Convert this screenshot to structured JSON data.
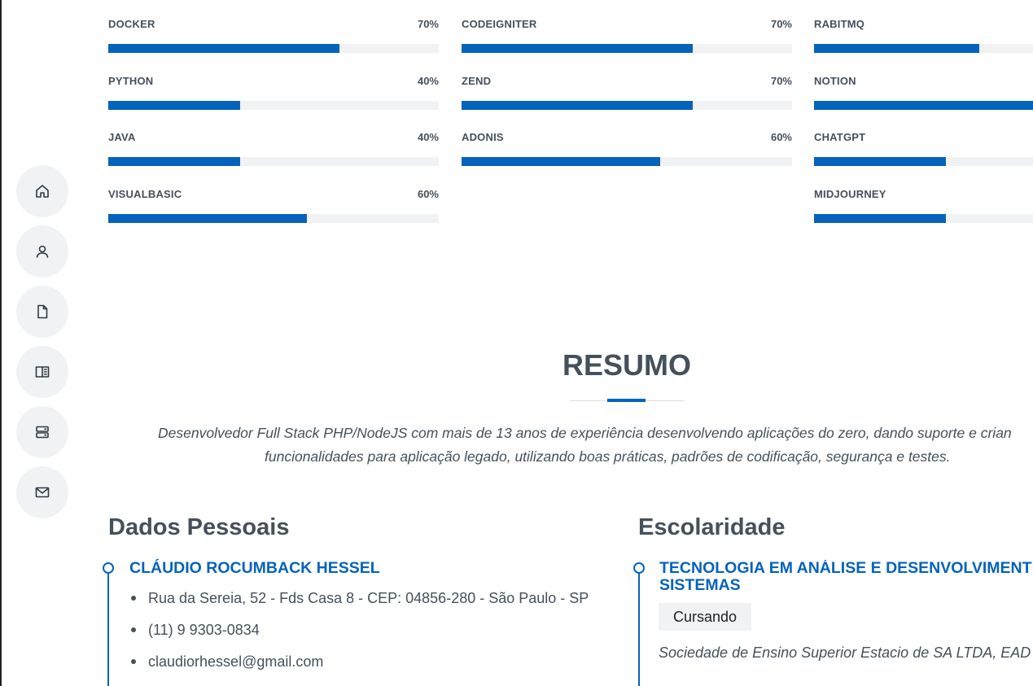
{
  "nav": {
    "items": [
      {
        "name": "home-icon"
      },
      {
        "name": "user-icon"
      },
      {
        "name": "file-icon"
      },
      {
        "name": "book-icon"
      },
      {
        "name": "server-icon"
      },
      {
        "name": "mail-icon"
      }
    ]
  },
  "skills": {
    "columns": [
      [
        {
          "name": "DOCKER",
          "value": "70%",
          "percent": 70
        },
        {
          "name": "PYTHON",
          "value": "40%",
          "percent": 40
        },
        {
          "name": "JAVA",
          "value": "40%",
          "percent": 40
        },
        {
          "name": "VISUALBASIC",
          "value": "60%",
          "percent": 60
        }
      ],
      [
        {
          "name": "CODEIGNITER",
          "value": "70%",
          "percent": 70
        },
        {
          "name": "ZEND",
          "value": "70%",
          "percent": 70
        },
        {
          "name": "ADONIS",
          "value": "60%",
          "percent": 60
        }
      ],
      [
        {
          "name": "RABITMQ",
          "value": "",
          "percent": 50
        },
        {
          "name": "NOTION",
          "value": "",
          "percent": 67
        },
        {
          "name": "CHATGPT",
          "value": "",
          "percent": 40
        },
        {
          "name": "MIDJOURNEY",
          "value": "",
          "percent": 40
        }
      ]
    ]
  },
  "resumo": {
    "title": "RESUMO",
    "line1": "Desenvolvedor Full Stack PHP/NodeJS com mais de 13 anos de experiência desenvolvendo aplicações do zero, dando suporte e crian",
    "line2": "funcionalidades para aplicação legado, utilizando boas práticas, padrões de codificação, segurança e testes."
  },
  "dados": {
    "title": "Dados Pessoais",
    "name": "CLÁUDIO ROCUMBACK HESSEL",
    "address": "Rua da Sereia, 52 - Fds Casa 8 - CEP: 04856-280 - São Paulo - SP",
    "phone": "(11) 9 9303-0834",
    "email": "claudiorhessel@gmail.com"
  },
  "escolaridade": {
    "title": "Escolaridade",
    "course_line1": "TECNOLOGIA EM ANÁLISE E DESENVOLVIMENT",
    "course_line2": "SISTEMAS",
    "status": "Cursando",
    "institution": "Sociedade de Ensino Superior Estacio de SA LTDA, EAD"
  },
  "colors": {
    "accent": "#0563bb",
    "text": "#45505b",
    "track": "#f0f2f4"
  }
}
